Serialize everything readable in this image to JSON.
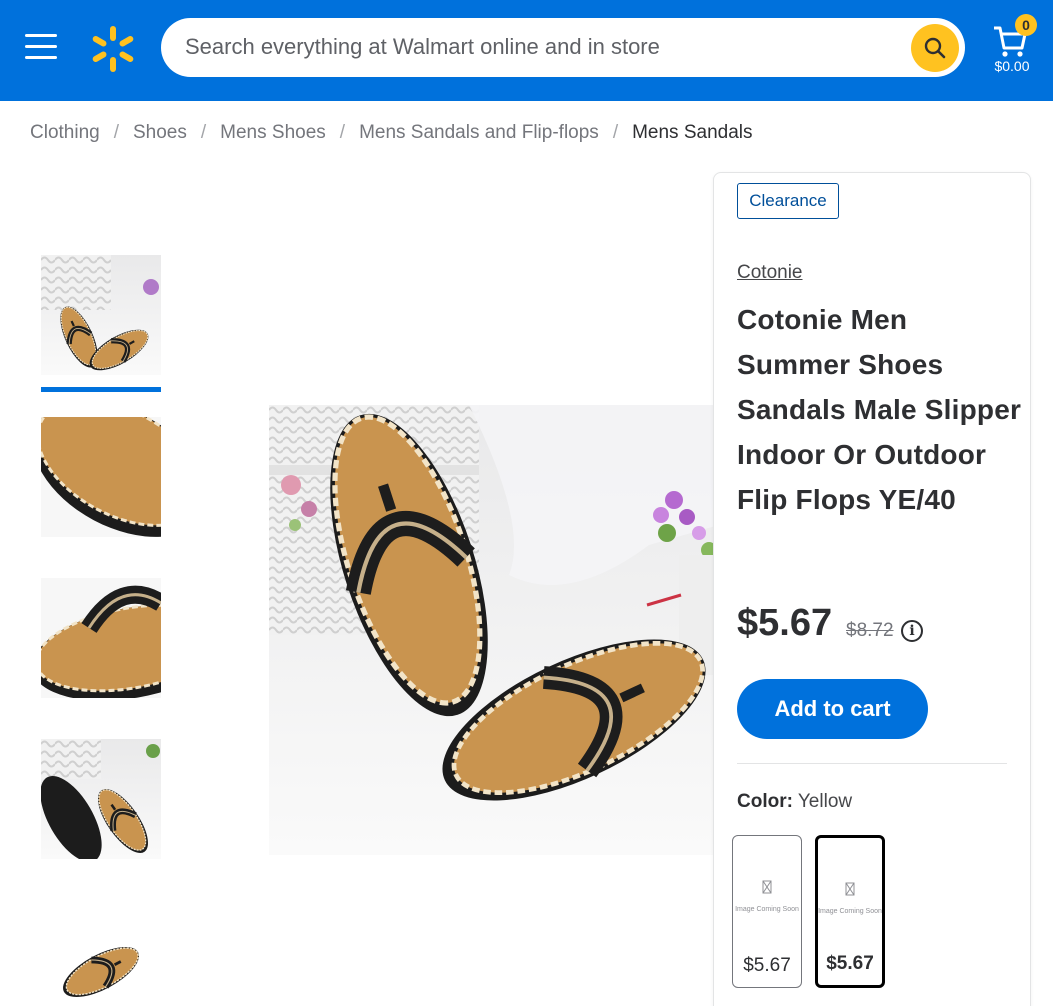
{
  "header": {
    "search_placeholder": "Search everything at Walmart online and in store",
    "cart_count": "0",
    "cart_total": "$0.00",
    "brand_color": "#0071dc",
    "accent_color": "#ffc220"
  },
  "breadcrumb": [
    "Clothing",
    "Shoes",
    "Mens Shoes",
    "Mens Sandals and Flip-flops",
    "Mens Sandals"
  ],
  "gallery": {
    "thumbnail_count": 5,
    "selected_index": 0
  },
  "product": {
    "badge": "Clearance",
    "brand": "Cotonie",
    "title_lines": [
      "Cotonie Men",
      "Summer Shoes",
      "Sandals Male Slipper",
      "Indoor Or Outdoor",
      "Flip Flops YE/40"
    ],
    "price": "$5.67",
    "was_price": "$8.72",
    "info_icon": "i",
    "add_to_cart": "Add to cart",
    "color_label": "Color:",
    "color_value": "Yellow",
    "swatches": [
      {
        "price": "$5.67",
        "image_text": "Image Coming Soon",
        "selected": false
      },
      {
        "price": "$5.67",
        "image_text": "Image Coming Soon",
        "selected": true
      }
    ]
  }
}
